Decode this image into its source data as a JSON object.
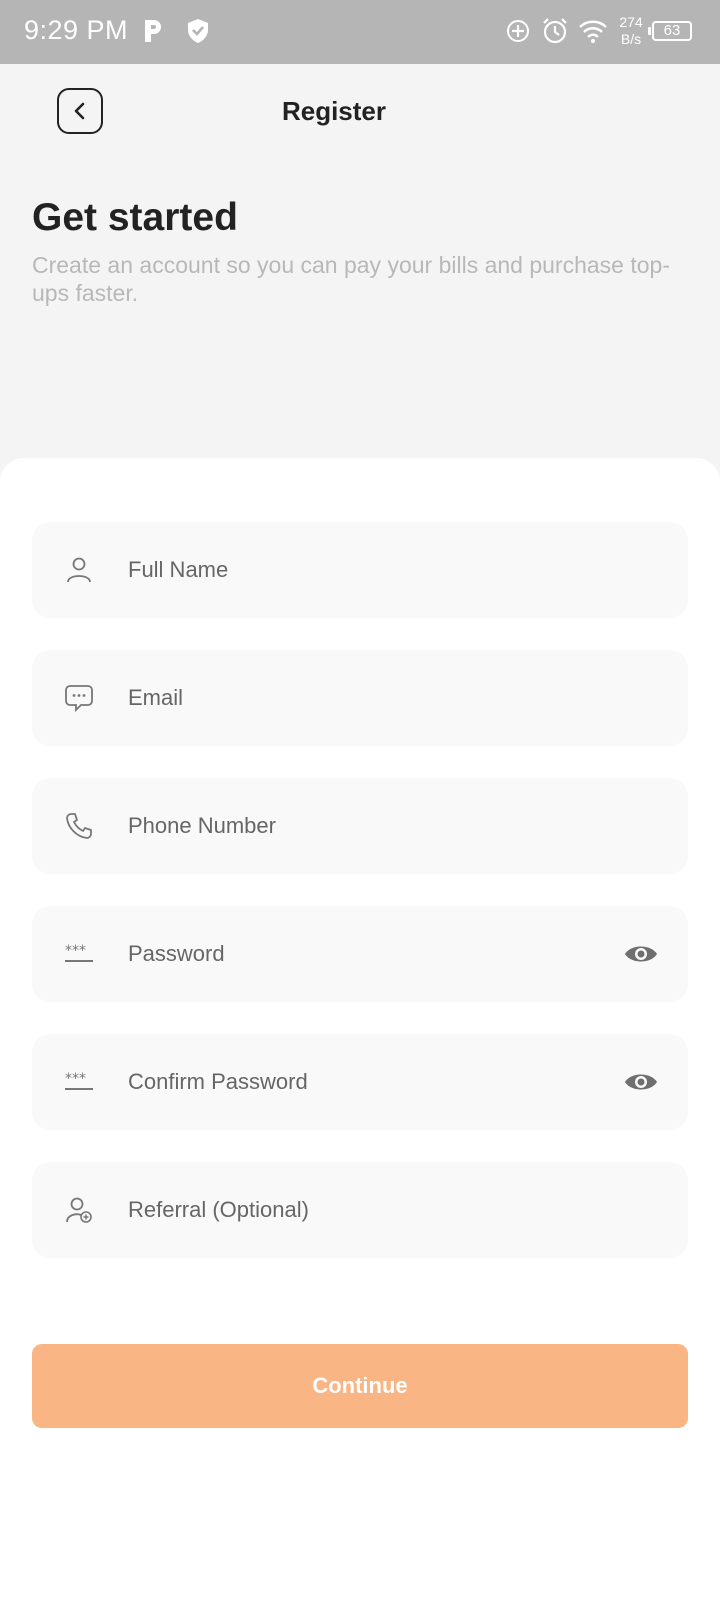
{
  "status_bar": {
    "time": "9:29 PM",
    "net_speed_value": "274",
    "net_speed_unit": "B/s",
    "battery": "63",
    "icons": [
      "p-icon",
      "shield-icon",
      "data-saver-icon",
      "alarm-icon",
      "wifi-icon",
      "battery-icon"
    ]
  },
  "header": {
    "back_icon": "chevron-left-icon",
    "title": "Register"
  },
  "intro": {
    "title": "Get started",
    "subtitle": "Create an account so you can pay your bills and purchase top-ups faster."
  },
  "form": {
    "fields": [
      {
        "icon": "user-icon",
        "placeholder": "Full Name",
        "value": ""
      },
      {
        "icon": "chat-icon",
        "placeholder": "Email",
        "value": ""
      },
      {
        "icon": "phone-icon",
        "placeholder": "Phone Number",
        "value": ""
      },
      {
        "icon": "password-icon",
        "placeholder": "Password",
        "value": "",
        "toggle_icon": "eye-icon"
      },
      {
        "icon": "password-icon",
        "placeholder": "Confirm Password",
        "value": "",
        "toggle_icon": "eye-icon"
      },
      {
        "icon": "user-add-icon",
        "placeholder": "Referral (Optional)",
        "value": ""
      }
    ],
    "submit_label": "Continue"
  },
  "colors": {
    "status_bar": "#b5b5b5",
    "background": "#f4f4f4",
    "card": "#ffffff",
    "field": "#f9f9f9",
    "accent": "#f9b583",
    "subtitle": "#b8b8b8"
  }
}
